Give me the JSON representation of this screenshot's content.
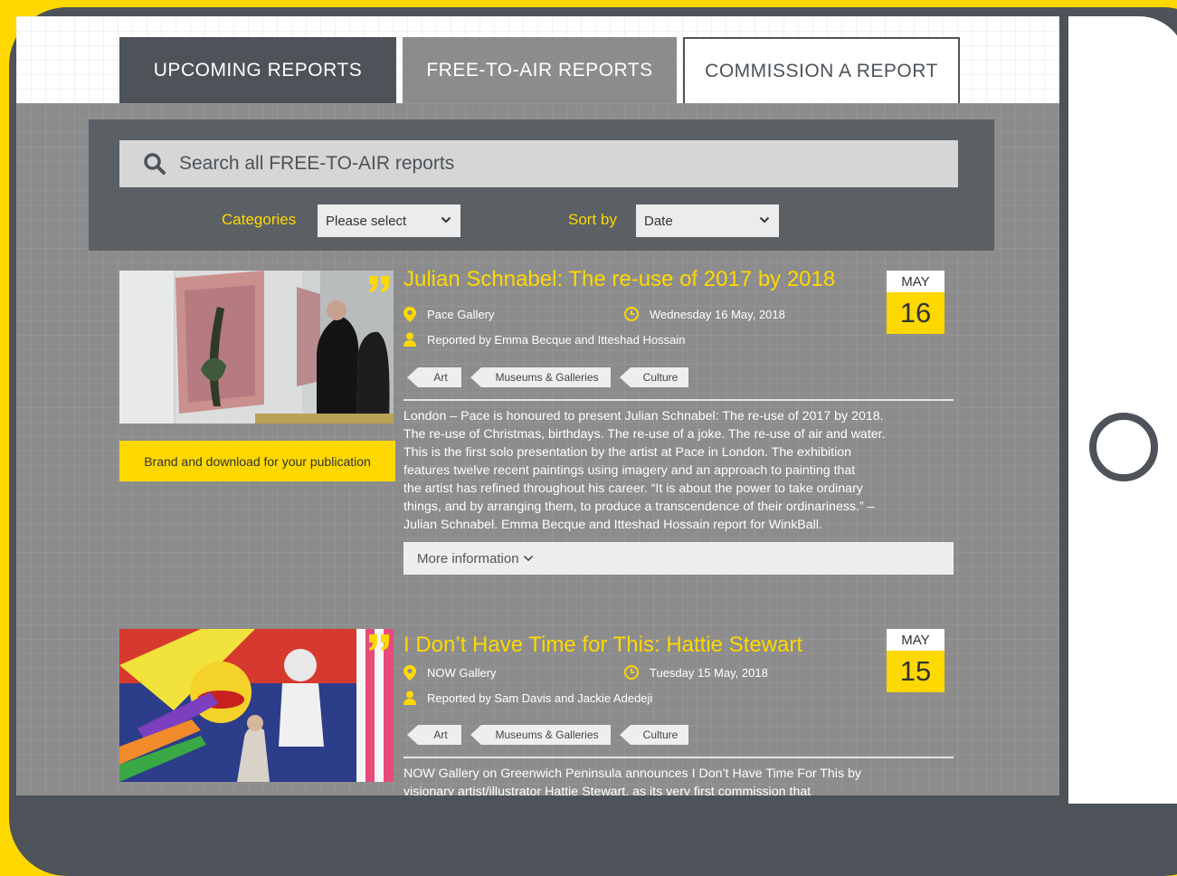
{
  "tabs": {
    "upcoming": "UPCOMING REPORTS",
    "free_to_air": "FREE-TO-AIR REPORTS",
    "commission": "COMMISSION A REPORT"
  },
  "search": {
    "placeholder": "Search all FREE-TO-AIR reports"
  },
  "filters": {
    "categories_label": "Categories",
    "categories_value": "Please select",
    "sort_label": "Sort by",
    "sort_value": "Date"
  },
  "reports": [
    {
      "title": "Julian Schnabel: The re-use of 2017 by 2018",
      "venue": "Pace Gallery",
      "date_text": "Wednesday 16 May, 2018",
      "reporters": "Reported by Emma Becque and Itteshad Hossain",
      "month": "MAY",
      "day": "16",
      "tags": [
        "Art",
        "Museums & Galleries",
        "Culture"
      ],
      "brand_button": "Brand and download for your publication",
      "description_lines": [
        "London – Pace is honoured to present Julian Schnabel: The re-use of 2017 by 2018.",
        "The re-use of Christmas, birthdays. The re-use of a joke. The re-use of air and water.",
        "This is the first solo presentation by the artist at Pace in London. The exhibition",
        "features twelve recent paintings using imagery and an approach to painting that",
        "the artist has refined throughout his career. “It is about the power to take ordinary",
        "things, and by arranging them, to produce a transcendence of their ordinariness.” –",
        "Julian Schnabel. Emma Becque and Itteshad Hossain report for WinkBall."
      ],
      "more_info": "More information"
    },
    {
      "title": "I Don’t Have Time for This: Hattie Stewart",
      "venue": "NOW Gallery",
      "date_text": "Tuesday 15 May, 2018",
      "reporters": "Reported by Sam Davis and Jackie Adedeji",
      "month": "MAY",
      "day": "15",
      "tags": [
        "Art",
        "Museums & Galleries",
        "Culture"
      ],
      "description_lines": [
        "NOW Gallery on Greenwich Peninsula announces I Don’t Have Time For This by",
        "visionary artist/illustrator Hattie Stewart, as its very first commission that"
      ]
    }
  ],
  "colors": {
    "accent": "#ffd800",
    "frame": "#4d5358",
    "panel": "#5b6065",
    "page": "#8c8c8c"
  },
  "icons": [
    "search-icon",
    "chevron-down-icon",
    "location-pin-icon",
    "clock-icon",
    "person-icon",
    "quote-icon",
    "home-button-icon"
  ]
}
